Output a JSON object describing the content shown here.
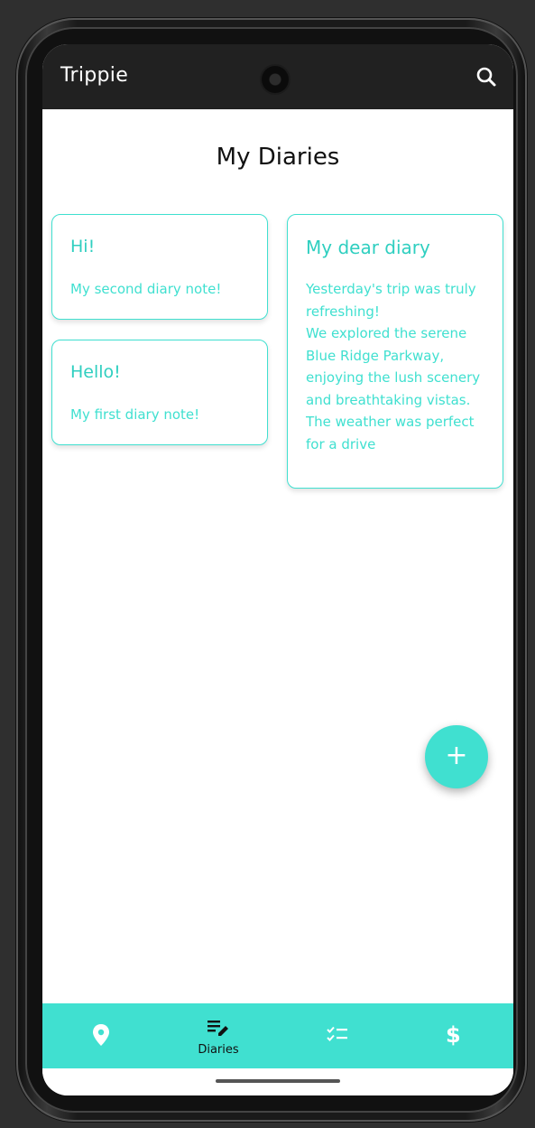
{
  "app_bar": {
    "title": "Trippie",
    "search_icon": "search-icon"
  },
  "page": {
    "title": "My Diaries"
  },
  "notes": [
    {
      "title": "Hi!",
      "body": "My second diary note!"
    },
    {
      "title": "Hello!",
      "body": "My first diary note!"
    },
    {
      "title": "My dear diary",
      "body": "Yesterday's trip was truly refreshing!\nWe explored the serene Blue Ridge Parkway, enjoying the lush scenery and breathtaking vistas. The weather was perfect for a drive"
    }
  ],
  "fab": {
    "label": "+",
    "icon": "add-icon"
  },
  "bottom_nav": {
    "items": [
      {
        "icon": "location-pin-icon",
        "label": ""
      },
      {
        "icon": "edit-note-icon",
        "label": "Diaries",
        "selected": true
      },
      {
        "icon": "checklist-icon",
        "label": ""
      },
      {
        "icon": "dollar-icon",
        "label": ""
      }
    ]
  },
  "colors": {
    "accent": "#40e0d0",
    "app_bar": "#212121",
    "background": "#ffffff"
  }
}
